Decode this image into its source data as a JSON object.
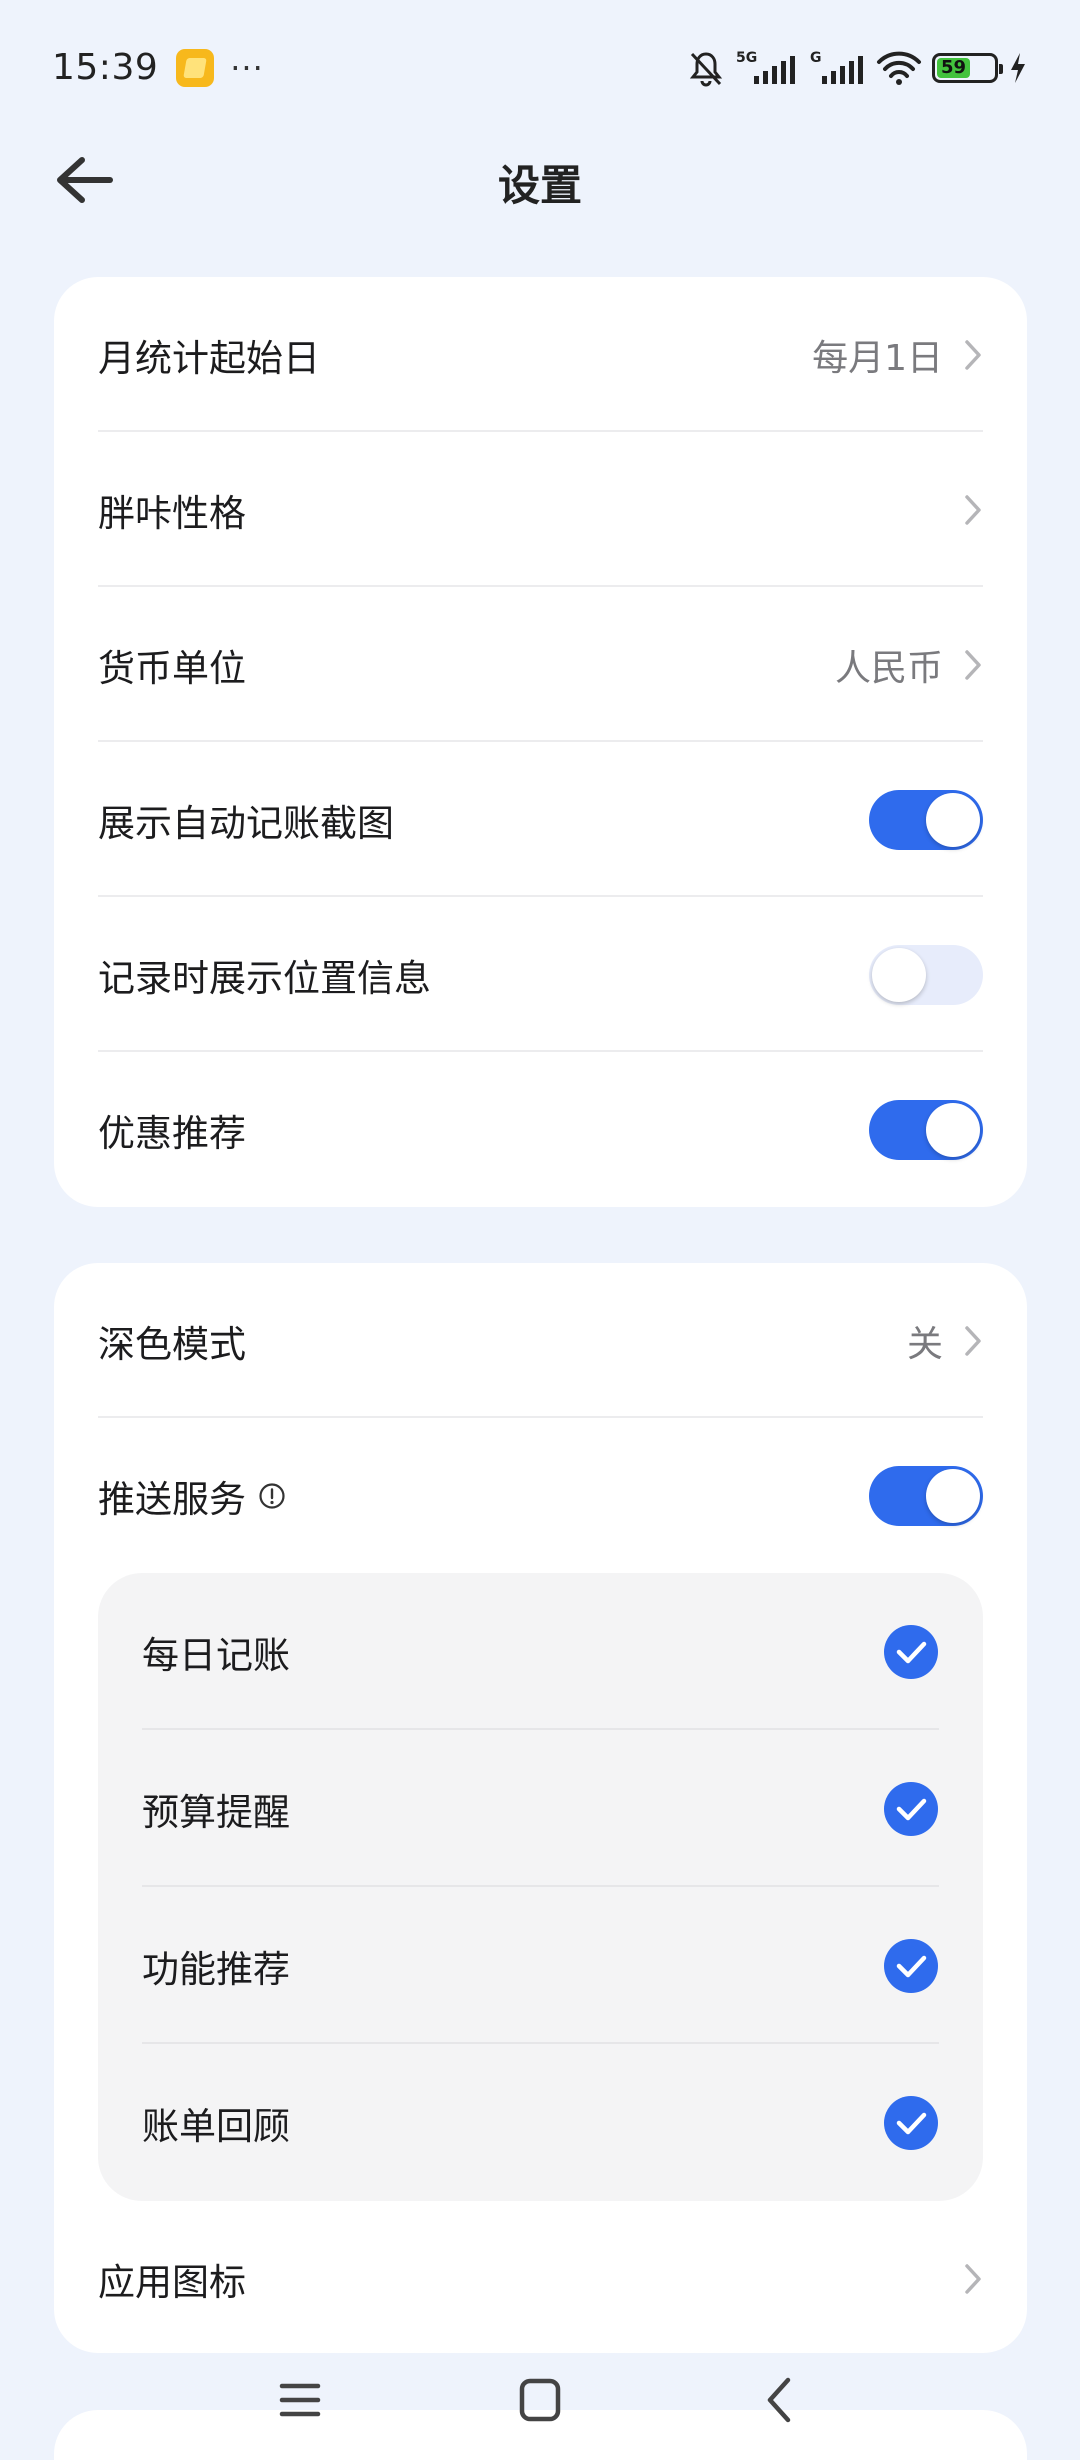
{
  "status_bar": {
    "time": "15:39",
    "dots": "···",
    "signal1_label": "5G",
    "signal2_label": "G",
    "battery": "59",
    "battery_level": 0.59
  },
  "header": {
    "title": "设置"
  },
  "section1": {
    "rows": [
      {
        "label": "月统计起始日",
        "value": "每月1日"
      },
      {
        "label": "胖咔性格",
        "value": ""
      },
      {
        "label": "货币单位",
        "value": "人民币"
      },
      {
        "label": "展示自动记账截图",
        "toggle": true
      },
      {
        "label": "记录时展示位置信息",
        "toggle": false
      },
      {
        "label": "优惠推荐",
        "toggle": true
      }
    ]
  },
  "section2": {
    "dark_mode": {
      "label": "深色模式",
      "value": "关"
    },
    "push_service": {
      "label": "推送服务",
      "toggle": true
    },
    "push_options": [
      {
        "label": "每日记账",
        "checked": true
      },
      {
        "label": "预算提醒",
        "checked": true
      },
      {
        "label": "功能推荐",
        "checked": true
      },
      {
        "label": "账单回顾",
        "checked": true
      }
    ],
    "app_icon": {
      "label": "应用图标"
    }
  },
  "colors": {
    "accent": "#2f6bed",
    "background": "#eef3fc",
    "toggle_off": "#e7ecfb"
  },
  "icons": {
    "back": "arrow-left-icon",
    "chevron": "chevron-right-icon",
    "info": "info-circle-icon",
    "check": "check-circle-icon"
  }
}
